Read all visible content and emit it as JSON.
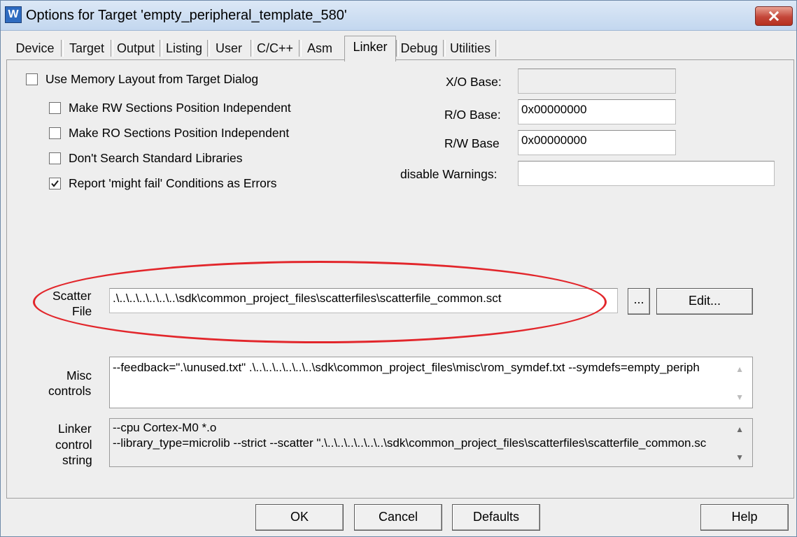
{
  "window": {
    "title": "Options for Target 'empty_peripheral_template_580'",
    "icon_letter": "W"
  },
  "tabs": [
    "Device",
    "Target",
    "Output",
    "Listing",
    "User",
    "C/C++",
    "Asm",
    "Linker",
    "Debug",
    "Utilities"
  ],
  "active_tab": "Linker",
  "checkboxes": {
    "use_memory_layout": {
      "label": "Use Memory Layout from Target Dialog",
      "checked": false
    },
    "rw_independent": {
      "label": "Make RW Sections Position Independent",
      "checked": false
    },
    "ro_independent": {
      "label": "Make RO Sections Position Independent",
      "checked": false
    },
    "no_std_libs": {
      "label": "Don't Search Standard Libraries",
      "checked": false
    },
    "might_fail_errors": {
      "label": "Report 'might fail' Conditions as Errors",
      "checked": true
    }
  },
  "fields": {
    "xo_base": {
      "label": "X/O Base:",
      "value": ""
    },
    "ro_base": {
      "label": "R/O Base:",
      "value": "0x00000000"
    },
    "rw_base": {
      "label": "R/W Base",
      "value": "0x00000000"
    },
    "disable_warnings": {
      "label": "disable Warnings:",
      "value": ""
    }
  },
  "scatter": {
    "label_line1": "Scatter",
    "label_line2": "File",
    "value": ".\\..\\..\\..\\..\\..\\..\\sdk\\common_project_files\\scatterfiles\\scatterfile_common.sct",
    "browse_label": "...",
    "edit_label": "Edit..."
  },
  "misc": {
    "label_line1": "Misc",
    "label_line2": "controls",
    "value": "--feedback=\".\\unused.txt\" .\\..\\..\\..\\..\\..\\..\\sdk\\common_project_files\\misc\\rom_symdef.txt  --symdefs=empty_periph"
  },
  "linker_control": {
    "label_line1": "Linker",
    "label_line2": "control",
    "label_line3": "string",
    "line1": "--cpu Cortex-M0 *.o",
    "line2": "--library_type=microlib --strict --scatter \".\\..\\..\\..\\..\\..\\..\\sdk\\common_project_files\\scatterfiles\\scatterfile_common.sc"
  },
  "buttons": {
    "ok": "OK",
    "cancel": "Cancel",
    "defaults": "Defaults",
    "help": "Help"
  },
  "icons": {
    "close": "close-icon",
    "checkmark": "checkmark-icon",
    "scroll_up": "scroll-up-icon",
    "scroll_down": "scroll-down-icon"
  },
  "colors": {
    "highlight_ellipse": "#e2262b",
    "close_button": "#c4473a",
    "titlebar": "#c3d7ef"
  }
}
